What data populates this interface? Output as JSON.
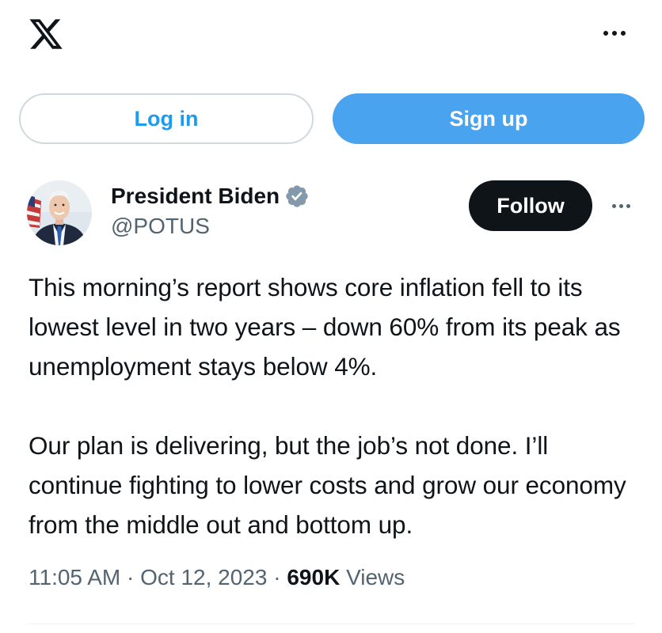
{
  "header": {
    "logo_icon": "x-logo-icon",
    "more_icon": "more-horizontal-icon"
  },
  "auth": {
    "login_label": "Log in",
    "signup_label": "Sign up"
  },
  "tweet": {
    "author": {
      "display_name": "President Biden",
      "handle": "@POTUS",
      "verified_icon": "verified-badge-icon",
      "verified_color": "#829aab"
    },
    "follow_label": "Follow",
    "more_icon": "more-horizontal-icon",
    "paragraphs": [
      "This morning’s report shows core inflation fell to its lowest level in two years – down 60% from its peak as unemployment stays below 4%.",
      "Our plan is delivering, but the job’s not done. I’ll continue fighting to lower costs and grow our economy from the middle out and bottom up."
    ],
    "time": "11:05 AM",
    "separator": "·",
    "date": "Oct 12, 2023",
    "views_count": "690K",
    "views_label": "Views"
  },
  "colors": {
    "brand_blue": "#1d9bf0",
    "signup_bg": "#4aa3ee",
    "text_primary": "#0f1419",
    "text_secondary": "#536471"
  }
}
